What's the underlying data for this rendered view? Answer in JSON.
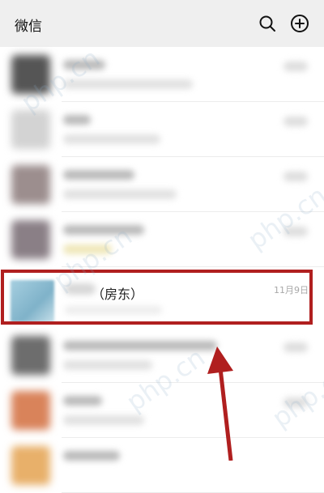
{
  "header": {
    "title": "微信"
  },
  "icons": {
    "search": "search-icon",
    "add": "plus-circle-icon"
  },
  "highlighted_chat": {
    "name_suffix": "（房东）",
    "time": "11月9日"
  },
  "watermark": "php.cn",
  "colors": {
    "highlight": "#b01f1f",
    "header_bg": "#efefef"
  }
}
